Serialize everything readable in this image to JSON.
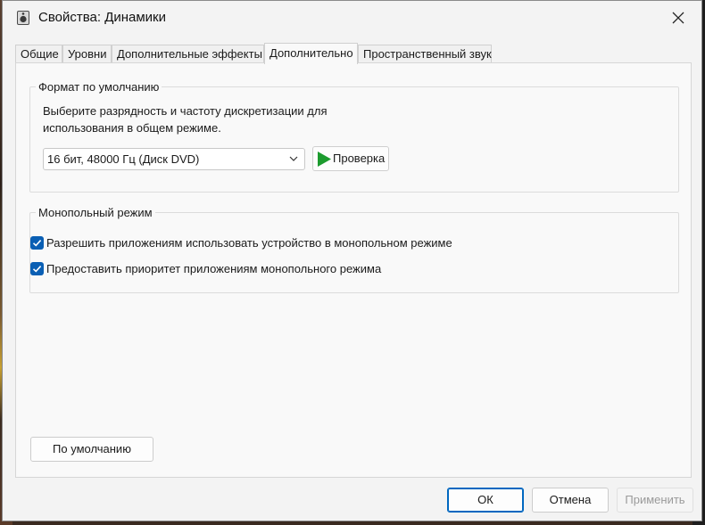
{
  "window": {
    "title": "Свойства: Динамики",
    "icon": "speaker-icon"
  },
  "tabs": [
    {
      "label": "Общие",
      "active": false
    },
    {
      "label": "Уровни",
      "active": false
    },
    {
      "label": "Дополнительные эффекты",
      "active": false
    },
    {
      "label": "Дополнительно",
      "active": true
    },
    {
      "label": "Пространственный звук",
      "active": false
    }
  ],
  "default_format": {
    "legend": "Формат по умолчанию",
    "description_line1": "Выберите разрядность и частоту дискретизации для",
    "description_line2": "использования в общем режиме.",
    "selected_format": "16 бит, 48000 Гц (Диск DVD)",
    "test_button": "Проверка"
  },
  "exclusive_mode": {
    "legend": "Монопольный режим",
    "options": [
      {
        "label": "Разрешить приложениям использовать устройство в монопольном режиме",
        "checked": true
      },
      {
        "label": "Предоставить приоритет приложениям монопольного режима",
        "checked": true
      }
    ]
  },
  "restore_defaults_button": "По умолчанию",
  "footer": {
    "ok": "ОК",
    "cancel": "Отмена",
    "apply": "Применить"
  },
  "colors": {
    "accent": "#0067c0",
    "checkbox": "#0a5fb4",
    "play": "#1c9b2e"
  }
}
